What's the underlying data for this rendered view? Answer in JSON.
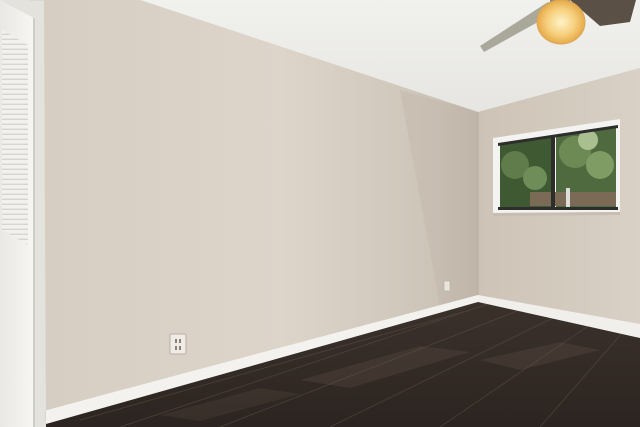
{
  "scene": {
    "room": "empty bedroom",
    "elements": [
      "ceiling",
      "left-wall",
      "right-wall",
      "closet-door",
      "window",
      "ceiling-fan",
      "wall-outlet",
      "baseboard",
      "wood-floor"
    ]
  },
  "colors": {
    "ceiling": "#eeeeeb",
    "left_wall": "#d8d0c4",
    "left_wall_shadow": "#c4baaf",
    "right_wall": "#d4cbbf",
    "baseboard": "#f4f2ee",
    "floor_dark": "#2e2621",
    "floor_mid": "#453a33",
    "window_frame": "#f3f3f1",
    "foliage": "#4f6a3e",
    "fan_light": "#f3c46a",
    "fan_blade": "#5b5046"
  }
}
